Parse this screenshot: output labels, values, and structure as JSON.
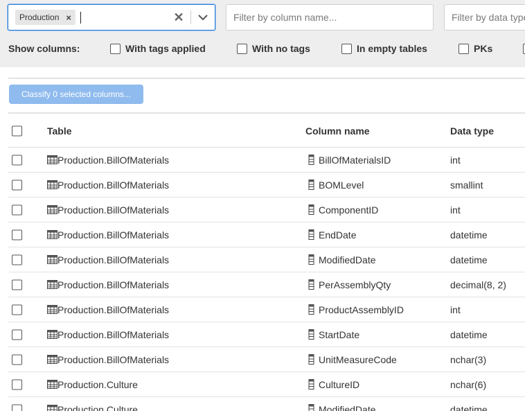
{
  "filters": {
    "schema_chip": "Production",
    "column_placeholder": "Filter by column name...",
    "datatype_placeholder": "Filter by data type..."
  },
  "show_columns": {
    "label": "Show columns:",
    "options": [
      {
        "label": "With tags applied",
        "checked": false
      },
      {
        "label": "With no tags",
        "checked": false
      },
      {
        "label": "In empty tables",
        "checked": false
      },
      {
        "label": "PKs",
        "checked": false
      }
    ]
  },
  "classify_button": "Classify 0 selected columns...",
  "grid": {
    "headers": {
      "table": "Table",
      "column": "Column name",
      "type": "Data type"
    },
    "rows": [
      {
        "table": "Production.BillOfMaterials",
        "column": "BillOfMaterialsID",
        "type": "int"
      },
      {
        "table": "Production.BillOfMaterials",
        "column": "BOMLevel",
        "type": "smallint"
      },
      {
        "table": "Production.BillOfMaterials",
        "column": "ComponentID",
        "type": "int"
      },
      {
        "table": "Production.BillOfMaterials",
        "column": "EndDate",
        "type": "datetime"
      },
      {
        "table": "Production.BillOfMaterials",
        "column": "ModifiedDate",
        "type": "datetime"
      },
      {
        "table": "Production.BillOfMaterials",
        "column": "PerAssemblyQty",
        "type": "decimal(8, 2)"
      },
      {
        "table": "Production.BillOfMaterials",
        "column": "ProductAssemblyID",
        "type": "int"
      },
      {
        "table": "Production.BillOfMaterials",
        "column": "StartDate",
        "type": "datetime"
      },
      {
        "table": "Production.BillOfMaterials",
        "column": "UnitMeasureCode",
        "type": "nchar(3)"
      },
      {
        "table": "Production.Culture",
        "column": "CultureID",
        "type": "nchar(6)"
      },
      {
        "table": "Production.Culture",
        "column": "ModifiedDate",
        "type": "datetime"
      }
    ]
  },
  "icons": {
    "table": "table-grid-icon",
    "column": "column-icon",
    "clear": "close-icon",
    "dropdown": "chevron-down-icon"
  },
  "colors": {
    "accent": "#2f7bd8",
    "button_disabled": "#8fbbee",
    "filter_bg": "#eeeeee"
  }
}
